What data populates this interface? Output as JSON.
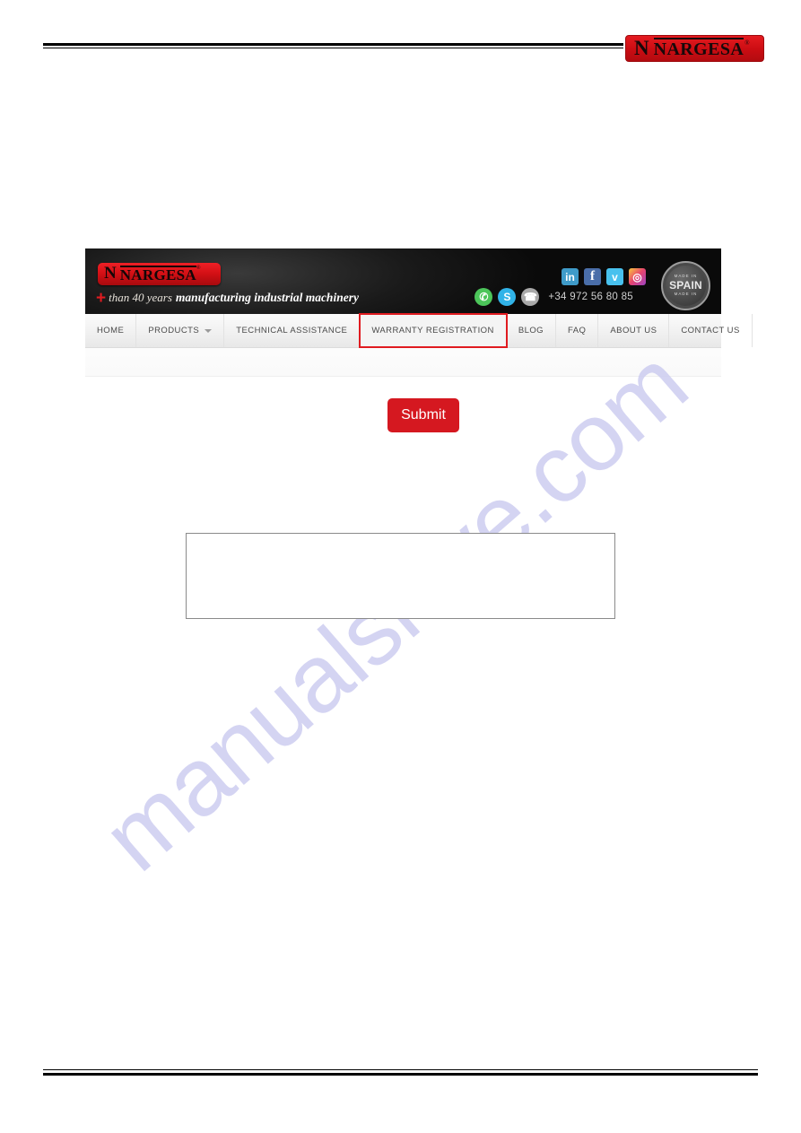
{
  "document": {
    "corner_logo": {
      "monogram": "N",
      "wordmark": "NARGESA",
      "registered_mark": "®"
    }
  },
  "watermark": {
    "text": "manualshive.com"
  },
  "website": {
    "logo": {
      "monogram": "N",
      "wordmark": "NARGESA",
      "registered_mark": "®"
    },
    "tagline": {
      "plus": "+",
      "years": "than 40 years",
      "rest": "manufacturing industrial machinery"
    },
    "contact": {
      "phone": "+34 972 56 80 85"
    },
    "social": [
      {
        "name": "linkedin-icon",
        "glyph": "in",
        "color": "#3f9bc9"
      },
      {
        "name": "facebook-icon",
        "glyph": "f",
        "color": "#4a6ea9"
      },
      {
        "name": "twitter-icon",
        "glyph": "ᴠ",
        "color": "#48c1ee"
      },
      {
        "name": "instagram-icon",
        "glyph": "◎",
        "color": "#e8456e"
      },
      {
        "name": "whatsapp-icon",
        "glyph": "✆",
        "color": "#4cc55a"
      },
      {
        "name": "skype-icon",
        "glyph": "S",
        "color": "#31b3e8"
      },
      {
        "name": "phone-icon",
        "glyph": "☎",
        "color": "#a9a9a9"
      }
    ],
    "badge": {
      "top_text": "MADE IN",
      "main_text": "SPAIN",
      "bottom_text": "MADE IN"
    },
    "nav": {
      "items": [
        {
          "label": "HOME",
          "has_dropdown": false,
          "highlighted": false
        },
        {
          "label": "PRODUCTS",
          "has_dropdown": true,
          "highlighted": false
        },
        {
          "label": "TECHNICAL ASSISTANCE",
          "has_dropdown": false,
          "highlighted": false
        },
        {
          "label": "WARRANTY REGISTRATION",
          "has_dropdown": false,
          "highlighted": true
        },
        {
          "label": "BLOG",
          "has_dropdown": false,
          "highlighted": false
        },
        {
          "label": "FAQ",
          "has_dropdown": false,
          "highlighted": false
        },
        {
          "label": "ABOUT US",
          "has_dropdown": false,
          "highlighted": false
        },
        {
          "label": "CONTACT US",
          "has_dropdown": false,
          "highlighted": false
        }
      ],
      "highlight_color": "#e01b20"
    }
  },
  "form": {
    "submit_label": "Submit",
    "submit_color": "#d51820",
    "text_area_value": ""
  }
}
